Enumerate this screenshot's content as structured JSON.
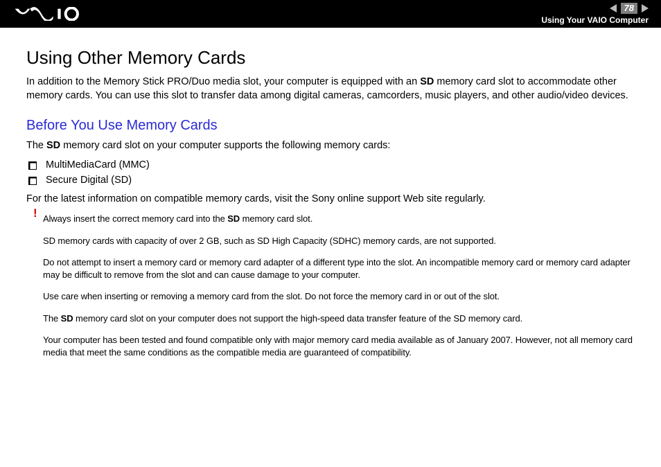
{
  "header": {
    "page_number": "78",
    "breadcrumb": "Using Your VAIO Computer"
  },
  "main": {
    "title": "Using Other Memory Cards",
    "intro_pre": "In addition to the Memory Stick PRO/Duo media slot, your computer is equipped with an ",
    "intro_bold": "SD",
    "intro_post": " memory card slot to accommodate other memory cards. You can use this slot to transfer data among digital cameras, camcorders, music players, and other audio/video devices.",
    "subheading": "Before You Use Memory Cards",
    "supports_pre": "The ",
    "supports_bold": "SD",
    "supports_post": " memory card slot on your computer supports the following memory cards:",
    "list": [
      "MultiMediaCard (MMC)",
      "Secure Digital (SD)"
    ],
    "latest_info": "For the latest information on compatible memory cards, visit the Sony online support Web site regularly.",
    "warning_mark": "!",
    "warnings": {
      "w1_pre": "Always insert the correct memory card into the ",
      "w1_bold": "SD",
      "w1_post": " memory card slot.",
      "w2": "SD memory cards with capacity of over 2 GB, such as SD High Capacity (SDHC) memory cards, are not supported.",
      "w3": "Do not attempt to insert a memory card or memory card adapter of a different type into the slot. An incompatible memory card or memory card adapter may be difficult to remove from the slot and can cause damage to your computer.",
      "w4": "Use care when inserting or removing a memory card from the slot. Do not force the memory card in or out of the slot.",
      "w5_pre": "The ",
      "w5_bold": "SD",
      "w5_post": " memory card slot on your computer does not support the high-speed data transfer feature of the SD memory card.",
      "w6": "Your computer has been tested and found compatible only with major memory card media available as of January 2007. However, not all memory card media that meet the same conditions as the compatible media are guaranteed of compatibility."
    }
  }
}
